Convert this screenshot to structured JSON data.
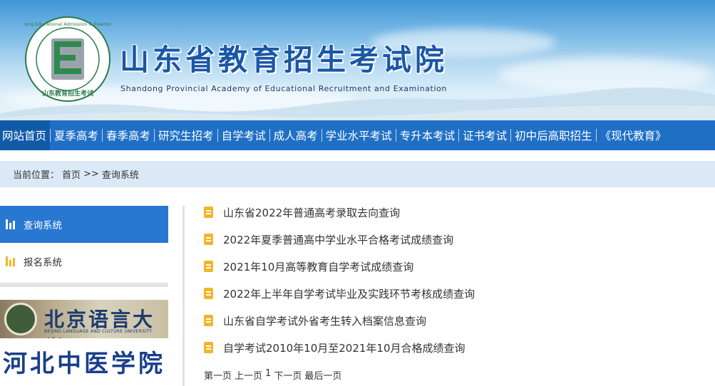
{
  "header": {
    "title": "山东省教育招生考试院",
    "subtitle": "Shandong Provincial Academy of Educational Recruitment and Examination",
    "logo_ring_text": "Shandong Educational Admission & Examinations",
    "logo_bottom_text": "山东教育招生考试",
    "logo_letter": "E"
  },
  "nav": {
    "items": [
      {
        "label": "网站首页",
        "active": true
      },
      {
        "label": "夏季高考"
      },
      {
        "label": "春季高考"
      },
      {
        "label": "研究生招考"
      },
      {
        "label": "自学考试"
      },
      {
        "label": "成人高考"
      },
      {
        "label": "学业水平考试"
      },
      {
        "label": "专升本考试"
      },
      {
        "label": "证书考试"
      },
      {
        "label": "初中后高职招生"
      },
      {
        "label": "《现代教育》"
      }
    ]
  },
  "breadcrumb": {
    "prefix": "当前位置：",
    "home": "首页",
    "sep": ">>",
    "current": "查询系统"
  },
  "sidebar": {
    "items": [
      {
        "label": "查询系统",
        "icon": "bar-chart-icon",
        "active": true
      },
      {
        "label": "报名系统",
        "icon": "bar-chart-icon"
      }
    ],
    "ads": [
      {
        "title": "北京语言大学",
        "subtitle": "BEIJING LANGUAGE AND CULTURE UNIVERSITY"
      },
      {
        "title": "河北中医学院"
      }
    ]
  },
  "list": {
    "items": [
      "山东省2022年普通高考录取去向查询",
      "2022年夏季普通高中学业水平合格考试成绩查询",
      "2021年10月高等教育自学考试成绩查询",
      "2022年上半年自学考试毕业及实践环节考核成绩查询",
      "山东省自学考试外省考生转入档案信息查询",
      "自学考试2010年10月至2021年10月合格成绩查询"
    ]
  },
  "pager": {
    "first": "第一页",
    "prev": "上一页",
    "page": "1",
    "next": "下一页",
    "last": "最后一页"
  },
  "colors": {
    "nav_bg": "#1f6fc5",
    "nav_active": "#115aa8",
    "sidebar_active": "#2877d1",
    "breadcrumb_bg": "#dbe8f6",
    "doc_icon": "#f3b52a",
    "title": "#1a57a6"
  }
}
